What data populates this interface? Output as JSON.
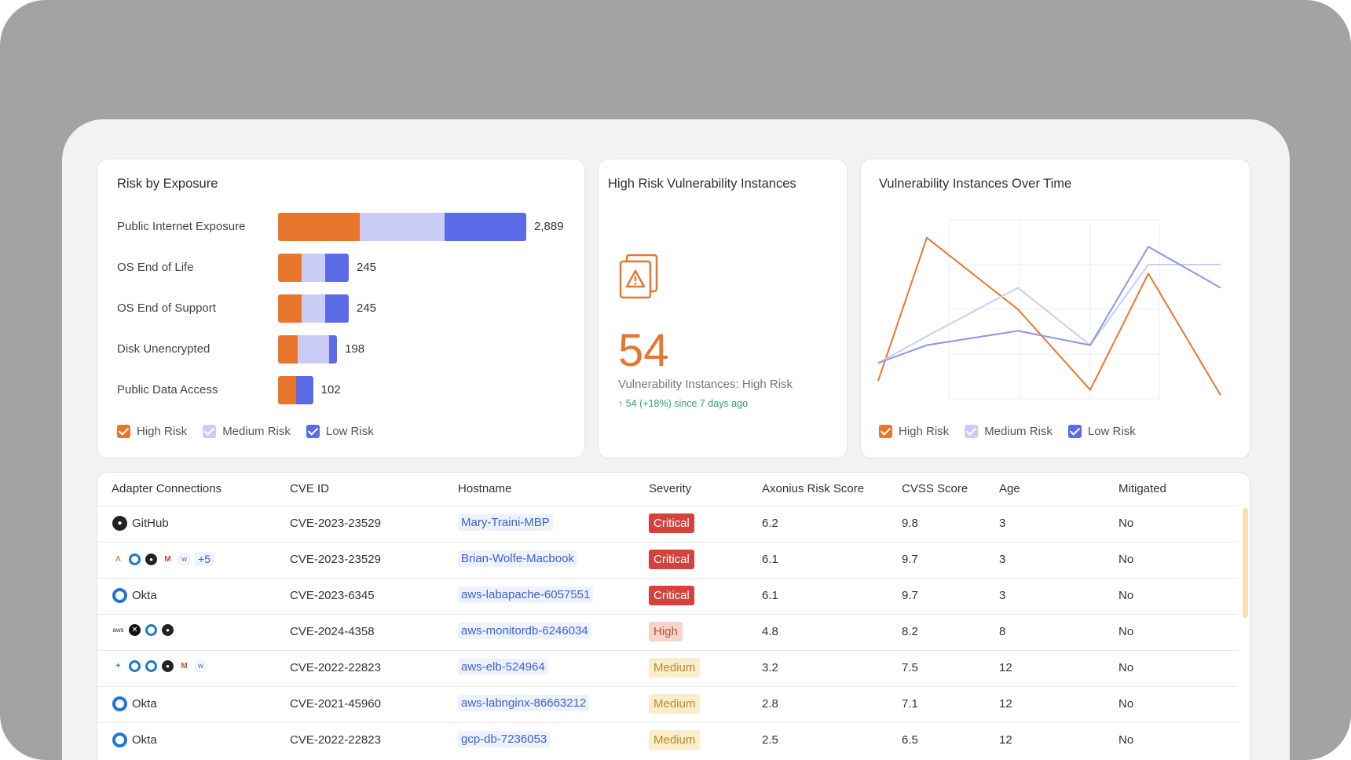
{
  "exposure": {
    "title": "Risk by Exposure",
    "rows": [
      {
        "label": "Public Internet Exposure",
        "total": "2,889",
        "segments": {
          "high": 0.33,
          "medium": 0.34,
          "low": 0.33
        }
      },
      {
        "label": "OS End of Life",
        "total": "245",
        "segments": {
          "high": 0.33,
          "medium": 0.34,
          "low": 0.33
        }
      },
      {
        "label": "OS End of Support",
        "total": "245",
        "segments": {
          "high": 0.33,
          "medium": 0.34,
          "low": 0.33
        }
      },
      {
        "label": "Disk Unencrypted",
        "total": "198",
        "segments": {
          "high": 0.33,
          "medium": 0.54,
          "low": 0.13
        }
      },
      {
        "label": "Public Data Access",
        "total": "102",
        "segments": {
          "high": 0.52,
          "medium": 0.0,
          "low": 0.48
        }
      }
    ],
    "legend": {
      "high": "High Risk",
      "medium": "Medium Risk",
      "low": "Low Risk"
    }
  },
  "high_risk": {
    "title": "High Risk Vulnerability Instances",
    "value": "54",
    "label": "Vulnerability Instances: High Risk",
    "trend": "↑ 54 (+18%) since 7 days ago"
  },
  "over_time": {
    "title": "Vulnerability Instances Over Time",
    "legend": {
      "high": "High Risk",
      "medium": "Medium Risk",
      "low": "Low Risk"
    }
  },
  "colors": {
    "high": "#e8762d",
    "medium": "#c9cdf5",
    "low": "#5b6be8",
    "critical": "#d5423c"
  },
  "chart_data": {
    "type": "line",
    "title": "Vulnerability Instances Over Time",
    "x": [
      0,
      1,
      2,
      3,
      4,
      5
    ],
    "ylim": [
      0,
      100
    ],
    "series": [
      {
        "name": "High Risk",
        "values": [
          10,
          90,
          50,
          5,
          70,
          2
        ]
      },
      {
        "name": "Medium Risk",
        "values": [
          20,
          35,
          62,
          30,
          75,
          75
        ]
      },
      {
        "name": "Low Risk",
        "values": [
          20,
          30,
          38,
          30,
          85,
          62
        ]
      }
    ],
    "grid": true,
    "legend_position": "bottom"
  },
  "table": {
    "headers": [
      "Adapter Connections",
      "CVE ID",
      "Hostname",
      "Severity",
      "Axonius Risk Score",
      "CVSS Score",
      "Age",
      "Mitigated"
    ],
    "rows": [
      {
        "adapter": "GitHub",
        "adapter_icons": [
          "github-icon"
        ],
        "cve": "CVE-2023-23529",
        "host": "Mary-Traini-MBP",
        "severity": "Critical",
        "risk": "6.2",
        "cvss": "9.8",
        "age": "3",
        "mitigated": "No"
      },
      {
        "adapter": "",
        "adapter_icons": [
          "aws-lambda-icon",
          "okta-icon",
          "github-icon",
          "gmail-icon",
          "wiz-icon"
        ],
        "adapter_more": "+5",
        "cve": "CVE-2023-23529",
        "host": "Brian-Wolfe-Macbook",
        "severity": "Critical",
        "risk": "6.1",
        "cvss": "9.7",
        "age": "3",
        "mitigated": "No"
      },
      {
        "adapter": "Okta",
        "adapter_icons": [
          "okta-icon"
        ],
        "cve": "CVE-2023-6345",
        "host": "aws-labapache-6057551",
        "severity": "Critical",
        "risk": "6.1",
        "cvss": "9.7",
        "age": "3",
        "mitigated": "No"
      },
      {
        "adapter": "",
        "adapter_icons": [
          "aws-icon",
          "x-icon",
          "okta-icon",
          "github-icon"
        ],
        "cve": "CVE-2024-4358",
        "host": "aws-monitordb-6246034",
        "severity": "High",
        "risk": "4.8",
        "cvss": "8.2",
        "age": "8",
        "mitigated": "No"
      },
      {
        "adapter": "",
        "adapter_icons": [
          "gcp-icon",
          "okta-icon",
          "okta-icon",
          "github-icon",
          "gmail-icon",
          "wiz-icon"
        ],
        "cve": "CVE-2022-22823",
        "host": "aws-elb-524964",
        "severity": "Medium",
        "risk": "3.2",
        "cvss": "7.5",
        "age": "12",
        "mitigated": "No"
      },
      {
        "adapter": "Okta",
        "adapter_icons": [
          "okta-icon"
        ],
        "cve": "CVE-2021-45960",
        "host": "aws-labnginx-86663212",
        "severity": "Medium",
        "risk": "2.8",
        "cvss": "7.1",
        "age": "12",
        "mitigated": "No"
      },
      {
        "adapter": "Okta",
        "adapter_icons": [
          "okta-icon"
        ],
        "cve": "CVE-2022-22823",
        "host": "gcp-db-7236053",
        "severity": "Medium",
        "risk": "2.5",
        "cvss": "6.5",
        "age": "12",
        "mitigated": "No"
      }
    ]
  }
}
